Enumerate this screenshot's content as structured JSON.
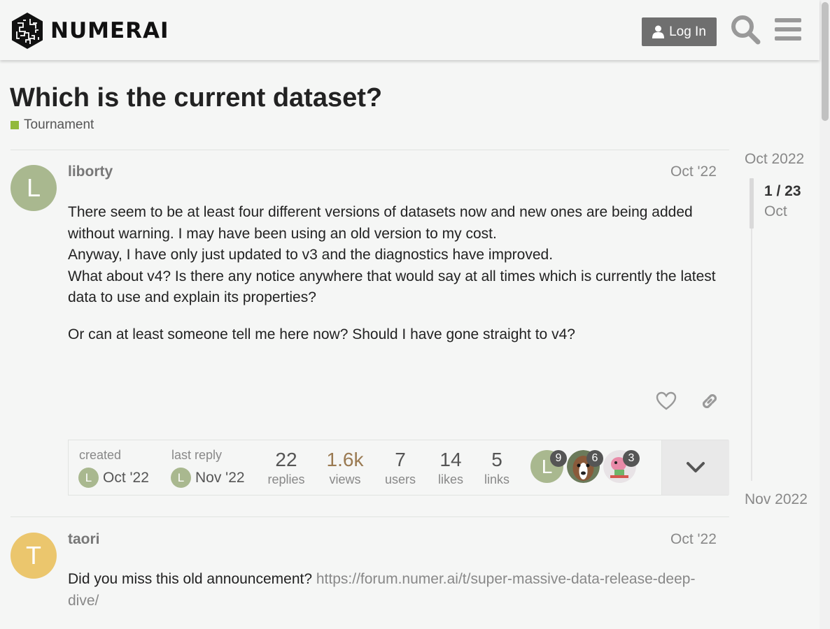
{
  "header": {
    "logo_text": "NUMERAI",
    "login_label": "Log In",
    "icons": [
      "user-icon",
      "search-icon",
      "hamburger-menu-icon"
    ]
  },
  "topic": {
    "title": "Which is the current dataset?",
    "category": "Tournament",
    "category_color": "#92b93c"
  },
  "posts": [
    {
      "avatar_letter": "L",
      "avatar_color": "#a9b88f",
      "username": "liborty",
      "date": "Oct '22",
      "paragraphs": [
        "There seem to be at least four different versions of datasets now and new ones are being added without warning. I may have been using an old version to my cost.",
        "Anyway, I have only just updated to v3 and the diagnostics have improved.",
        "What about v4? Is there any notice anywhere that would say at all times which is currently the latest data to use and explain its properties?",
        "Or can at least someone tell me here now? Should I have gone straight to v4?"
      ]
    },
    {
      "avatar_letter": "T",
      "avatar_color": "#ebc66d",
      "username": "taori",
      "date": "Oct '22",
      "text": "Did you miss this old announcement?",
      "link": "https://forum.numer.ai/t/super-massive-data-release-deep-dive/"
    }
  ],
  "topic_map": {
    "created_label": "created",
    "created_avatar": "L",
    "created_date": "Oct '22",
    "last_reply_label": "last reply",
    "last_reply_avatar": "L",
    "last_reply_date": "Nov '22",
    "stats": [
      {
        "value": "22",
        "label": "replies"
      },
      {
        "value": "1.6k",
        "label": "views"
      },
      {
        "value": "7",
        "label": "users"
      },
      {
        "value": "14",
        "label": "likes"
      },
      {
        "value": "5",
        "label": "links"
      }
    ],
    "participants": [
      {
        "letter": "L",
        "count": "9",
        "color": "#a9b88f"
      },
      {
        "letter": "",
        "count": "6",
        "color": "#8a5a3a"
      },
      {
        "letter": "",
        "count": "3",
        "color": "#e98aa8"
      }
    ]
  },
  "timeline": {
    "start": "Oct 2022",
    "position": "1 / 23",
    "current_month": "Oct",
    "end": "Nov 2022"
  }
}
